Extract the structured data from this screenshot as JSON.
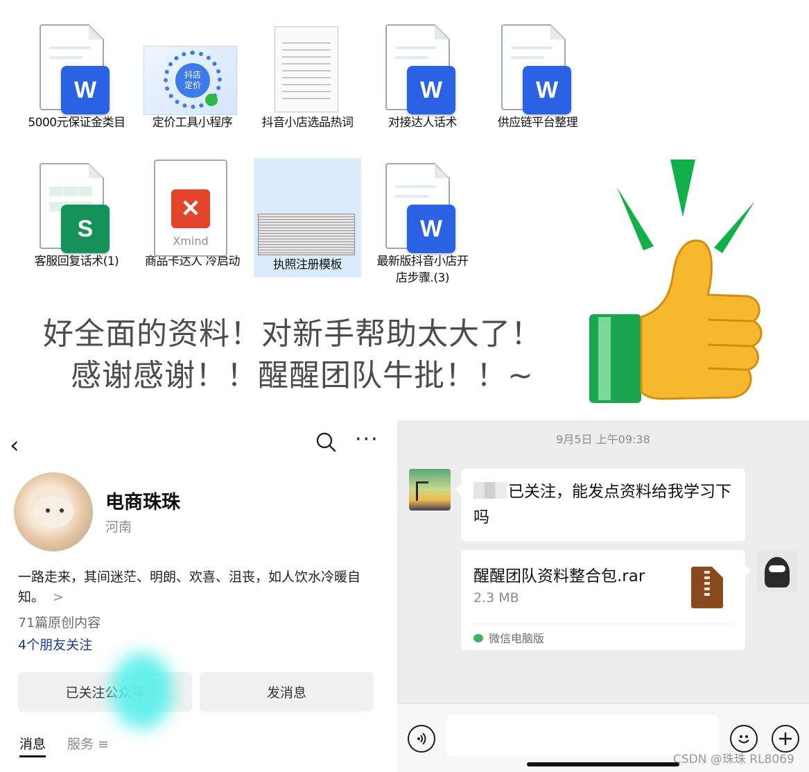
{
  "files": [
    {
      "label": "5000元保证金类目",
      "type": "word",
      "icon": "word-icon",
      "badge": "W"
    },
    {
      "label": "定价工具小程序",
      "type": "image",
      "icon": "qr-image-icon",
      "qr_text": "抖店\n定价"
    },
    {
      "label": "抖音小店选品热词",
      "type": "document",
      "icon": "text-doc-icon"
    },
    {
      "label": "对接达人话术",
      "type": "word",
      "icon": "word-icon",
      "badge": "W"
    },
    {
      "label": "供应链平台整理",
      "type": "word",
      "icon": "word-icon",
      "badge": "W"
    },
    {
      "label": "客服回复话术(1)",
      "type": "sheet",
      "icon": "sheet-icon",
      "badge": "S"
    },
    {
      "label": "商品卡达人 冷启动",
      "type": "xmind",
      "icon": "xmind-icon",
      "badge_text": "Xmind"
    },
    {
      "label": "执照注册模板",
      "type": "image",
      "icon": "license-image-icon",
      "selected": true
    },
    {
      "label": "最新版抖音小店开店步骤.(3)",
      "type": "word",
      "icon": "word-icon",
      "badge": "W"
    }
  ],
  "caption": {
    "line1": "好全面的资料！对新手帮助太大了！",
    "line2": "感谢感谢！！醒醒团队牛批！！~"
  },
  "profile": {
    "name": "电商珠珠",
    "region": "河南",
    "bio": "一路走来，其间迷茫、明朗、欢喜、沮丧，如人饮水冷暖自知。",
    "bio_more": ">",
    "original_count": "71篇原创内容",
    "friends_following": "4个朋友关注",
    "follow_button": "已关注公众号",
    "message_button": "发消息",
    "tabs": [
      {
        "label": "消息",
        "active": true
      },
      {
        "label": "服务 ≡",
        "active": false
      }
    ]
  },
  "chat": {
    "timestamp": "9月5日 上午09:38",
    "incoming_message": "已关注，能发点资料给我学习下吗",
    "file": {
      "name": "醒醒团队资料整合包.rar",
      "size": "2.3 MB",
      "source": "微信电脑版"
    }
  },
  "watermark": "CSDN @珠珠 RL8069",
  "colors": {
    "word_blue": "#2b62e3",
    "sheet_green": "#16915a",
    "xmind_red": "#e6452d",
    "thumb_gold": "#f5b82e",
    "spark_green": "#12b04a",
    "chat_bg": "#ededed",
    "link_blue": "#1b3a8c"
  }
}
